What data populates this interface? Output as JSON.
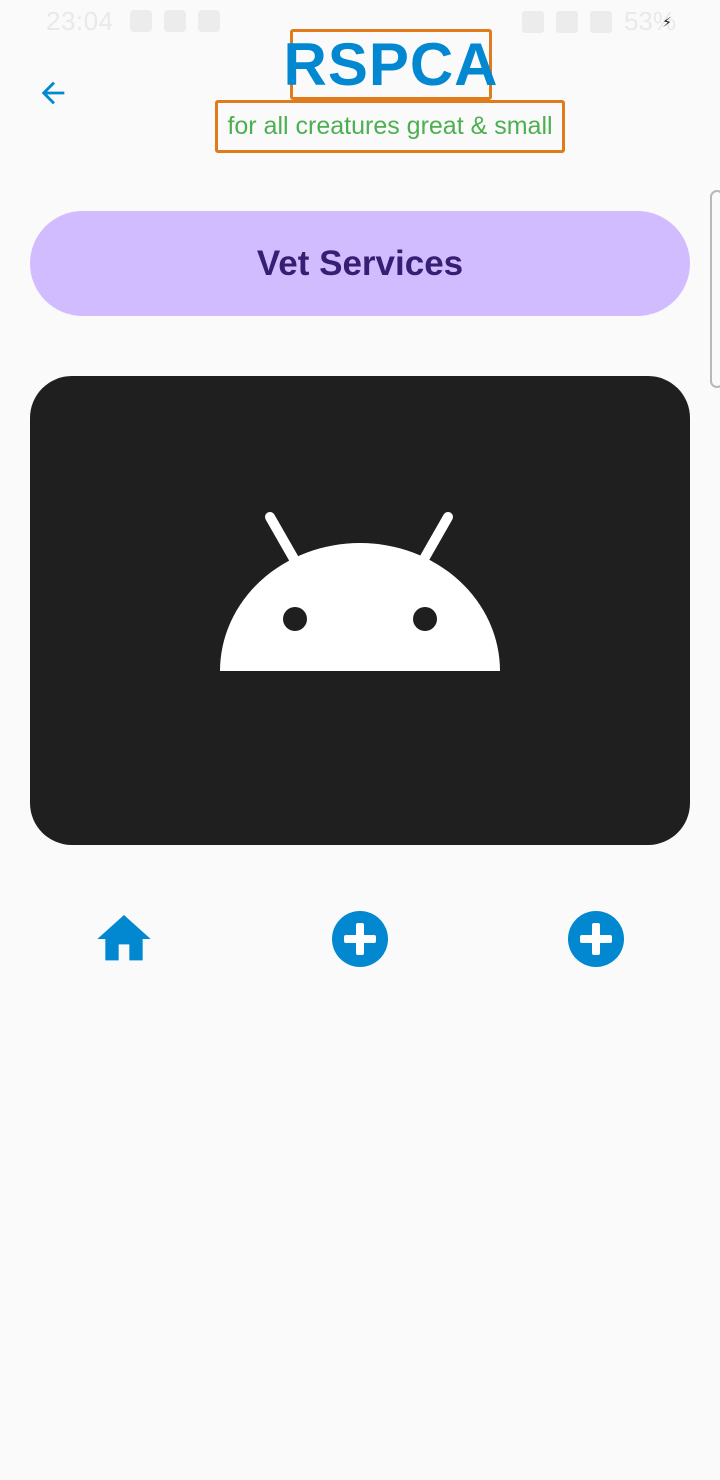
{
  "app": {
    "title": "RSPCA",
    "subtitle": "for all creatures great & small"
  },
  "status_bar": {
    "time": "23:04",
    "battery": "53%"
  },
  "header": {
    "back_icon": "arrow-left-icon"
  },
  "main": {
    "vet_button_label": "Vet Services",
    "image_icon": "android-placeholder-icon"
  },
  "nav": {
    "items": [
      {
        "icon": "home-icon"
      },
      {
        "icon": "add-circle-icon"
      },
      {
        "icon": "add-circle-icon"
      }
    ]
  },
  "colors": {
    "title": "#0288d1",
    "subtitle": "#4caf50",
    "highlight_border": "#e07b1b",
    "button_bg": "#d1bcff",
    "button_text": "#381e72",
    "card_bg": "#1f1f1f",
    "icon_blue": "#0288d1",
    "background": "#fafafa"
  }
}
